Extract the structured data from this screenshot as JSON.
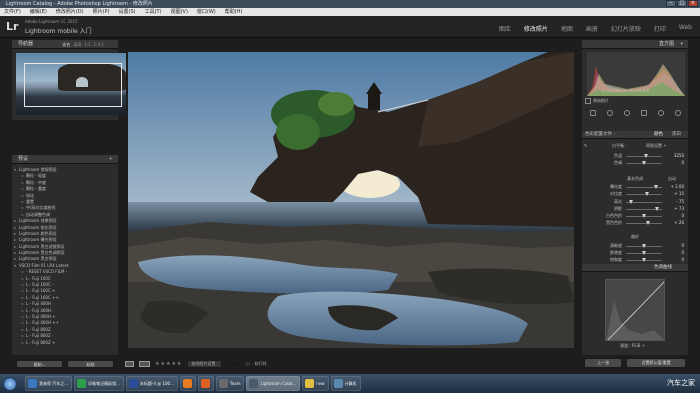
{
  "window": {
    "title": "Lightroom Catalog - Adobe Photoshop Lightroom - 修改照片"
  },
  "menu": [
    "文件(F)",
    "编辑(E)",
    "修改照片(D)",
    "照片(P)",
    "设置(S)",
    "工具(T)",
    "视图(V)",
    "窗口(W)",
    "帮助(H)"
  ],
  "identity": {
    "version": "Adobe Lightroom CC 2015",
    "name": "Lightroom mobile 入门"
  },
  "modules": [
    "图库",
    "修改照片",
    "地图",
    "画册",
    "幻灯片放映",
    "打印",
    "Web"
  ],
  "active_module": "修改照片",
  "navigator": {
    "title": "导航器",
    "opts": [
      "适合",
      "填满",
      "1:1",
      "1:4:1"
    ]
  },
  "presets": {
    "title": "预设",
    "items": [
      {
        "label": "Lightroom 常规预设",
        "kind": "folder",
        "open": true
      },
      {
        "label": "颗粒 - 轻度",
        "kind": "sub"
      },
      {
        "label": "颗粒 - 中度",
        "kind": "sub"
      },
      {
        "label": "颗粒 - 重度",
        "kind": "sub"
      },
      {
        "label": "锐化",
        "kind": "sub"
      },
      {
        "label": "重置",
        "kind": "sub"
      },
      {
        "label": "中/高对比度曲线",
        "kind": "sub"
      },
      {
        "label": "自动调整色调",
        "kind": "sub"
      },
      {
        "label": "Lightroom 效果预设",
        "kind": "folder"
      },
      {
        "label": "Lightroom 锐化预设",
        "kind": "folder"
      },
      {
        "label": "Lightroom 颜色预设",
        "kind": "folder"
      },
      {
        "label": "Lightroom 曝光预设",
        "kind": "folder"
      },
      {
        "label": "Lightroom 黑白滤镜预设",
        "kind": "folder"
      },
      {
        "label": "Lightroom 黑白色调预设",
        "kind": "folder"
      },
      {
        "label": "Lightroom 黑白预设",
        "kind": "folder"
      },
      {
        "label": "VSCO Film 01 LR4 Latest",
        "kind": "folder",
        "open": true
      },
      {
        "label": "- RESET VSCO FILM -",
        "kind": "sub"
      },
      {
        "label": "L - Fuji 160C",
        "kind": "sub"
      },
      {
        "label": "L - Fuji 160C -",
        "kind": "sub"
      },
      {
        "label": "L - Fuji 160C +",
        "kind": "sub"
      },
      {
        "label": "L - Fuji 160C ++",
        "kind": "sub"
      },
      {
        "label": "L - Fuji 400H",
        "kind": "sub"
      },
      {
        "label": "L - Fuji 400H -",
        "kind": "sub"
      },
      {
        "label": "L - Fuji 400H +",
        "kind": "sub"
      },
      {
        "label": "L - Fuji 400H ++",
        "kind": "sub"
      },
      {
        "label": "L - Fuji 800Z",
        "kind": "sub"
      },
      {
        "label": "L - Fuji 800Z -",
        "kind": "sub"
      },
      {
        "label": "L - Fuji 800Z +",
        "kind": "sub"
      }
    ]
  },
  "left_buttons": {
    "copy": "复制...",
    "paste": "粘贴"
  },
  "toolbar": {
    "rating": "★★★★★",
    "compare": "修改照片设置 :",
    "softproof": "软打样"
  },
  "histogram": {
    "title": "直方图",
    "info": "f/ 11   0 ISO  1/1  79.7   81.6 %",
    "original": "原始照片"
  },
  "develop": {
    "profile": "色彩配置文件 :",
    "profile_value": "颜色",
    "treatment": "黑白",
    "wb_label": "白平衡 :",
    "wb_value": "原照设置 ÷",
    "tone_section": "基本色调",
    "tone_auto": "自动",
    "presence_section": "偏好",
    "sliders": [
      {
        "label": "色温",
        "value": "3250",
        "pos": 0.55
      },
      {
        "label": "色调",
        "value": "0",
        "pos": 0.5
      },
      {
        "label": "曝光度",
        "value": "+ 2.00",
        "pos": 0.82
      },
      {
        "label": "对比度",
        "value": "+ 15",
        "pos": 0.58
      },
      {
        "label": "高光",
        "value": "- 75",
        "pos": 0.14
      },
      {
        "label": "阴影",
        "value": "+ 73",
        "pos": 0.86
      },
      {
        "label": "白色色阶",
        "value": "0",
        "pos": 0.5
      },
      {
        "label": "黑色色阶",
        "value": "+ 26",
        "pos": 0.62
      },
      {
        "label": "清晰度",
        "value": "0",
        "pos": 0.5
      },
      {
        "label": "鲜艳度",
        "value": "0",
        "pos": 0.5
      },
      {
        "label": "饱和度",
        "value": "0",
        "pos": 0.5
      }
    ]
  },
  "tone_curve": {
    "title": "色调曲线",
    "channel_label": "通道 :",
    "channel_value": "RGB ÷"
  },
  "right_buttons": {
    "prev": "上一张",
    "reset": "设置默认值/重置"
  },
  "taskbar": [
    {
      "label": "我来帮 汽车之...",
      "color": "#3a78c0"
    },
    {
      "label": "印象笔记精彩频...",
      "color": "#2f9e4a"
    },
    {
      "label": "未标题-4 @ 100...",
      "color": "#2a4c9a"
    },
    {
      "label": "",
      "color": "#e87a20"
    },
    {
      "label": "",
      "color": "#e06020"
    },
    {
      "label": "Team",
      "color": "#6a6a6a"
    },
    {
      "label": "Lightroom Catal...",
      "color": "#4a5a6a",
      "active": true
    },
    {
      "label": "new",
      "color": "#e0c040"
    },
    {
      "label": "计算机",
      "color": "#5a8ab0"
    }
  ],
  "watermark": "汽车之家"
}
